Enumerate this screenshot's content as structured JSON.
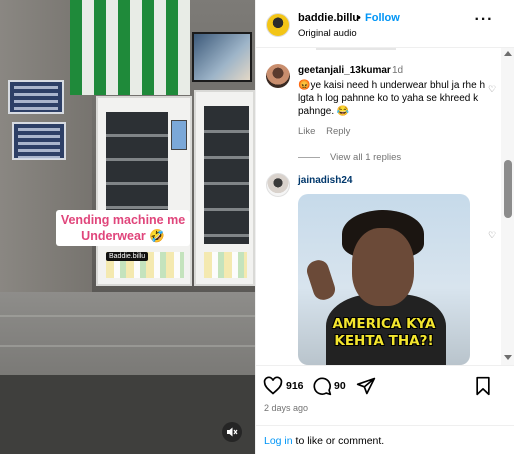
{
  "media": {
    "caption_line1": "Vending machine me",
    "caption_line2": "Underwear 🤣",
    "watermark": "Baddie.billu",
    "mute_icon": "speaker-muted-icon"
  },
  "post": {
    "username": "baddie.billu",
    "separator": "•",
    "follow_label": "Follow",
    "audio_label": "Original audio",
    "more_icon": "ellipsis-icon"
  },
  "comments": [
    {
      "username": "geetanjali_13kumar",
      "time": "1d",
      "text": "😡ye kaisi need h underwear bhul ja rhe h lgta h log pahnne ko to yaha se khreed k pahnge. 😂",
      "like_label": "Like",
      "reply_label": "Reply",
      "view_replies_label": "View all 1 replies"
    },
    {
      "username": "jainadish24",
      "gif_text_line1": "AMERICA KYA",
      "gif_text_line2": "KEHTA THA?!"
    }
  ],
  "actions": {
    "likes": "916",
    "comments": "90",
    "like_icon": "heart-icon",
    "comment_icon": "comment-bubble-icon",
    "share_icon": "paper-plane-icon",
    "save_icon": "bookmark-icon"
  },
  "date": "2 days ago",
  "login": {
    "link_label": "Log in",
    "suffix": " to like or comment."
  },
  "colors": {
    "accent": "#0095f6",
    "caption_text": "#e0457b",
    "muted": "#737373"
  }
}
